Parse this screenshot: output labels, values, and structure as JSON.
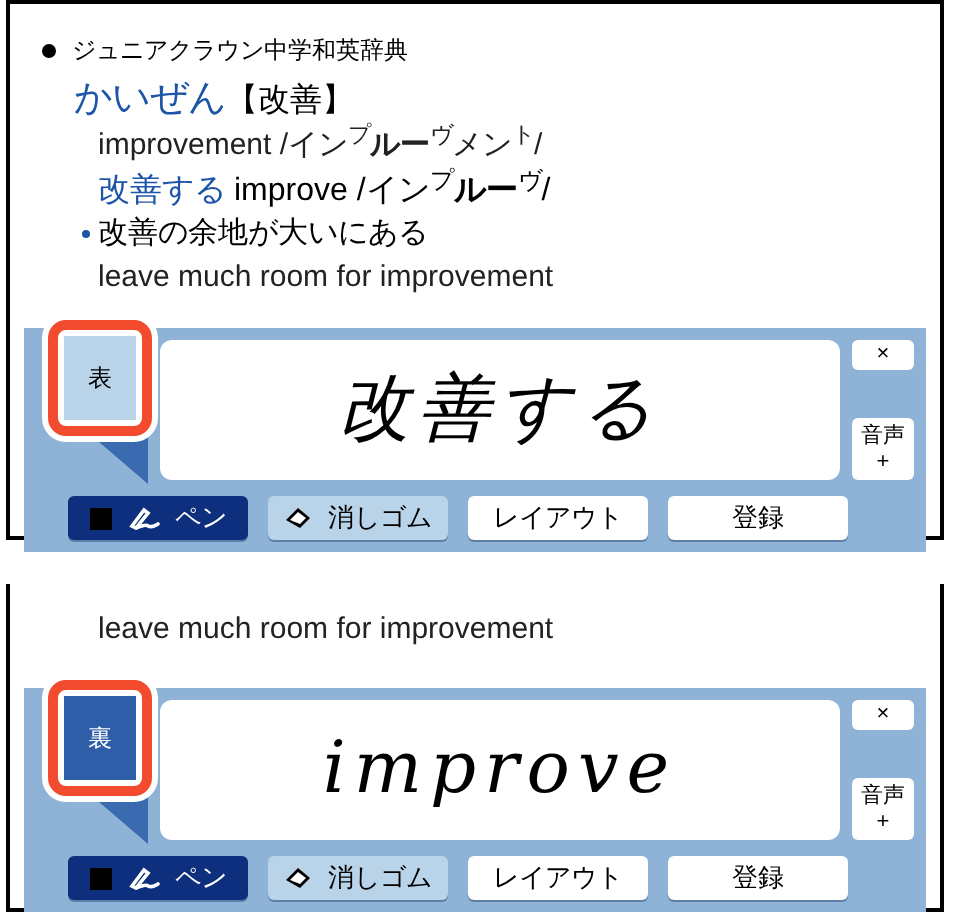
{
  "panels": [
    {
      "lines": [
        {
          "kind": "source",
          "text": "ジュニアクラウン中学和英辞典"
        },
        {
          "kind": "headword",
          "head": "かいぜん",
          "text": "【改善】"
        },
        {
          "kind": "plain",
          "text": "improvement /イン$^{プ}$**ルー**$^{ヴ}$メン$^{ト}$/"
        },
        {
          "kind": "phrase",
          "head": "改善する",
          "text": "improve /イン$^{プ}$**ルー**$^{ヴ}$/"
        },
        {
          "kind": "example",
          "text": "改善の余地が大いにある"
        },
        {
          "kind": "plain",
          "text": "leave much room for improvement"
        }
      ],
      "pad": {
        "side": {
          "label": "表",
          "dark": false
        },
        "ink": "改善する",
        "close": "×",
        "voice": [
          "音声",
          "+"
        ],
        "tools": [
          {
            "kind": "pen",
            "label": "ペン",
            "selected": true
          },
          {
            "kind": "eraser",
            "label": "消しゴム",
            "selected": false
          },
          {
            "kind": "action",
            "label": "レイアウト"
          },
          {
            "kind": "action",
            "label": "登録"
          }
        ]
      }
    },
    {
      "lines": [
        {
          "kind": "plain",
          "text": "leave much room for improvement"
        }
      ],
      "pad": {
        "side": {
          "label": "裏",
          "dark": true
        },
        "ink": "improve",
        "close": "×",
        "voice": [
          "音声",
          "+"
        ],
        "tools": [
          {
            "kind": "pen",
            "label": "ペン",
            "selected": true
          },
          {
            "kind": "eraser",
            "label": "消しゴム",
            "selected": false
          },
          {
            "kind": "action",
            "label": "レイアウト"
          },
          {
            "kind": "action",
            "label": "登録"
          }
        ]
      }
    }
  ]
}
